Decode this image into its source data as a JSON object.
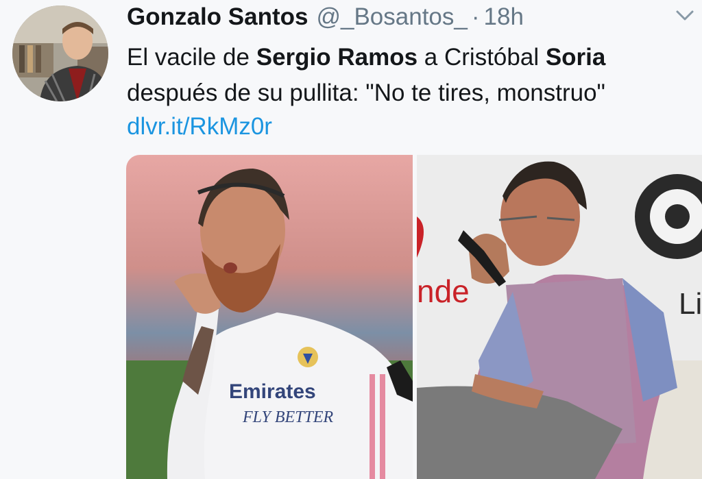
{
  "tweet": {
    "author_name": "Gonzalo Santos",
    "handle": "@_Bosantos_",
    "separator": "·",
    "time": "18h",
    "text_parts": {
      "p1": "El vacile de ",
      "b1": "Sergio Ramos",
      "p2": " a Cristóbal ",
      "b2": "Soria",
      "p3": " después de su pullita: \"No te tires, monstruo\""
    },
    "link": "dlvr.it/RkMz0r"
  },
  "media": {
    "left_photo": {
      "jersey_sponsor_line1": "Emirates",
      "jersey_sponsor_line2": "FLY BETTER"
    },
    "right_photo": {
      "banner_fragment": "nde",
      "logo_fragment": "Li"
    }
  },
  "colors": {
    "link": "#1b95e0",
    "secondary_text": "#657786",
    "primary_text": "#14171a",
    "background": "#f7f8fa"
  },
  "icons": [
    "chevron-down-icon",
    "avatar"
  ]
}
